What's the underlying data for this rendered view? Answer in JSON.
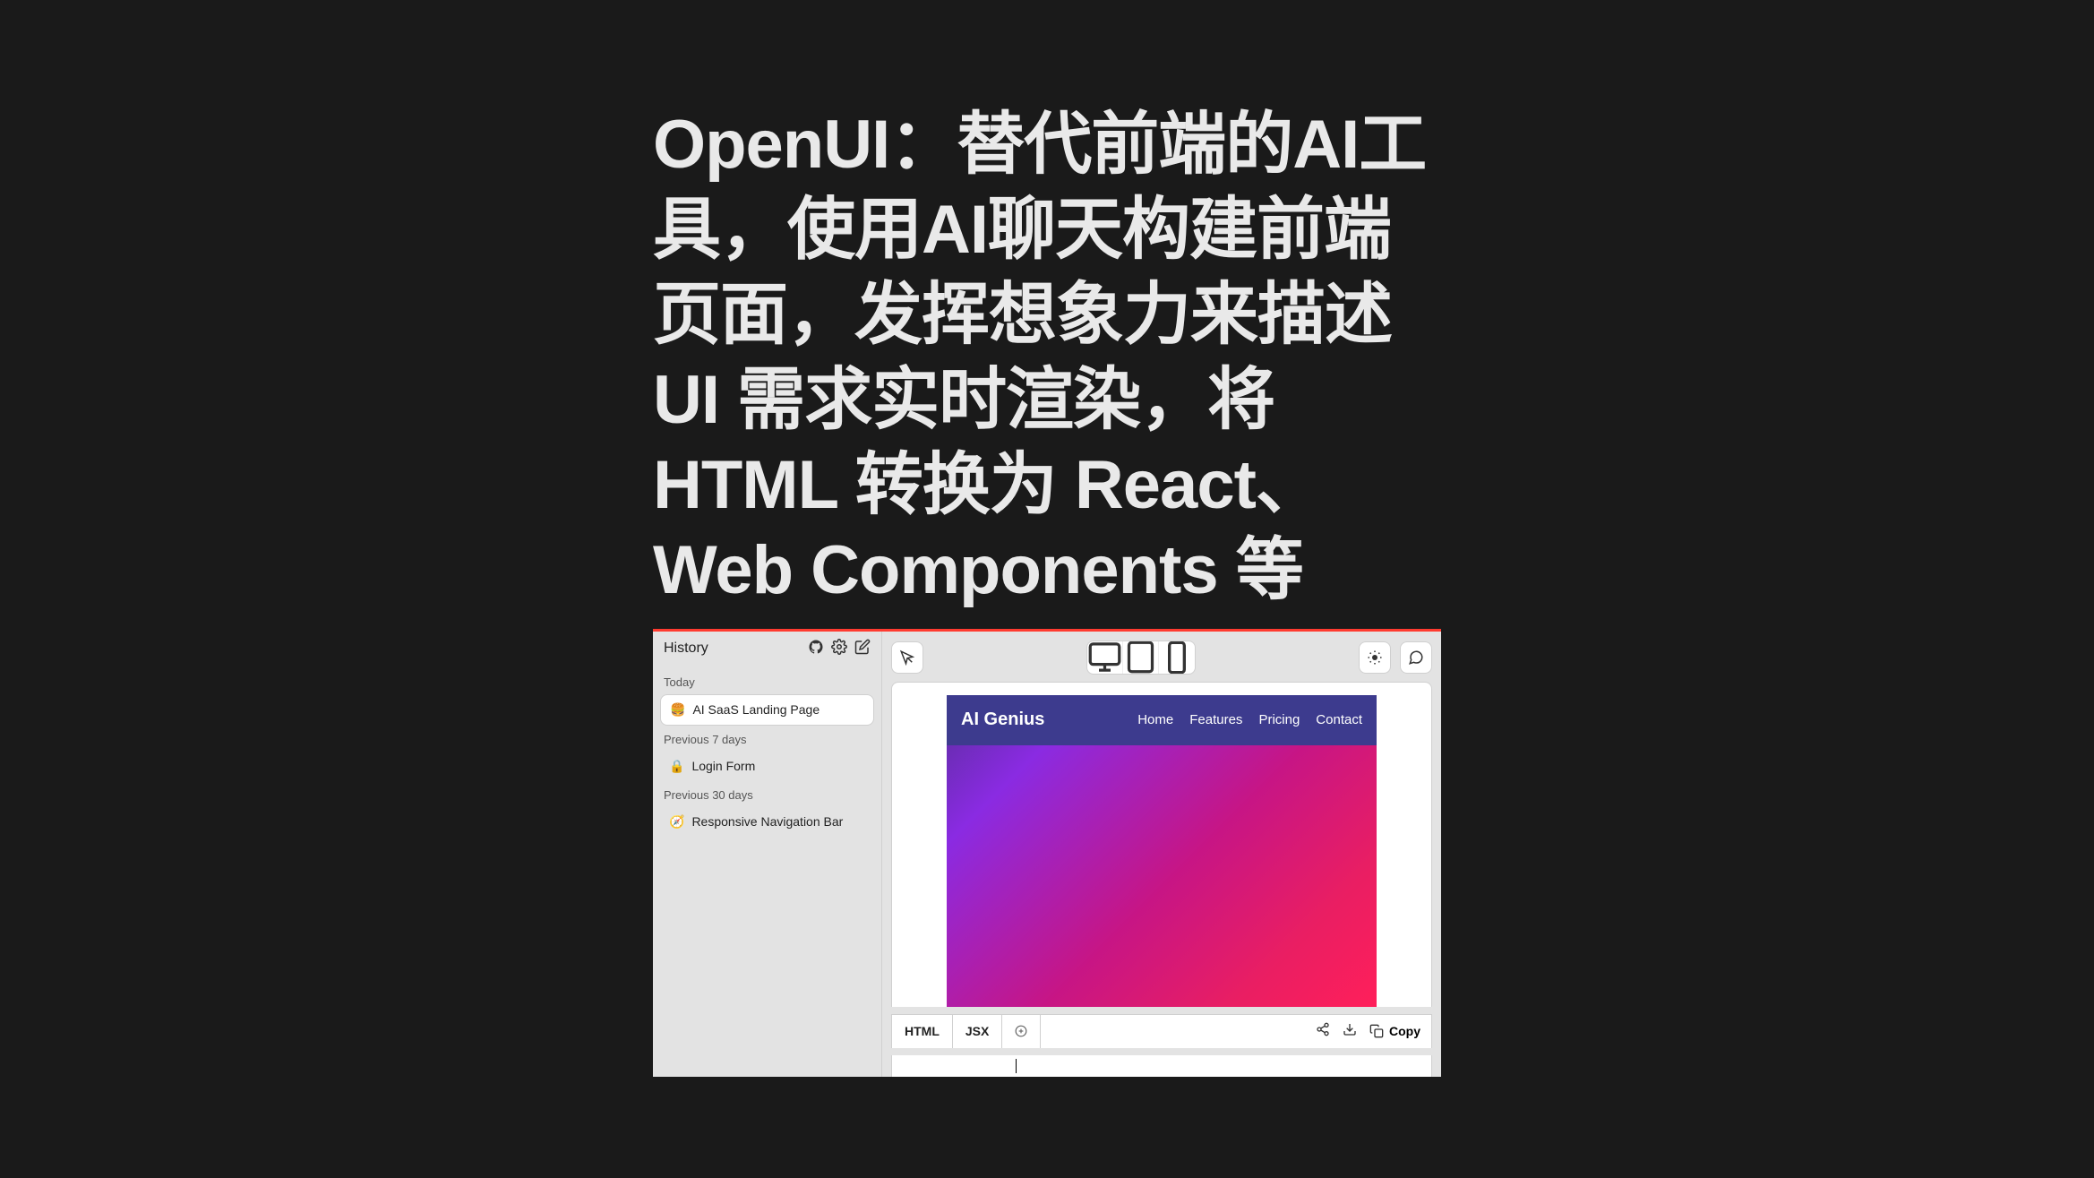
{
  "headline": "OpenUI：替代前端的AI工具，使用AI聊天构建前端页面，发挥想象力来描述 UI 需求实时渲染，将 HTML 转换为 React、Web Components 等",
  "sidebar": {
    "title": "History",
    "sections": [
      {
        "label": "Today",
        "items": [
          {
            "emoji": "🍔",
            "text": "AI SaaS Landing Page",
            "active": true
          }
        ]
      },
      {
        "label": "Previous 7 days",
        "items": [
          {
            "emoji": "🔒",
            "text": "Login Form",
            "active": false
          }
        ]
      },
      {
        "label": "Previous 30 days",
        "items": [
          {
            "emoji": "🧭",
            "text": "Responsive Navigation Bar",
            "active": false
          }
        ]
      }
    ]
  },
  "preview": {
    "brand": "AI Genius",
    "nav": [
      "Home",
      "Features",
      "Pricing",
      "Contact"
    ]
  },
  "code_bar": {
    "tabs": [
      "HTML",
      "JSX"
    ],
    "copy_label": "Copy"
  }
}
